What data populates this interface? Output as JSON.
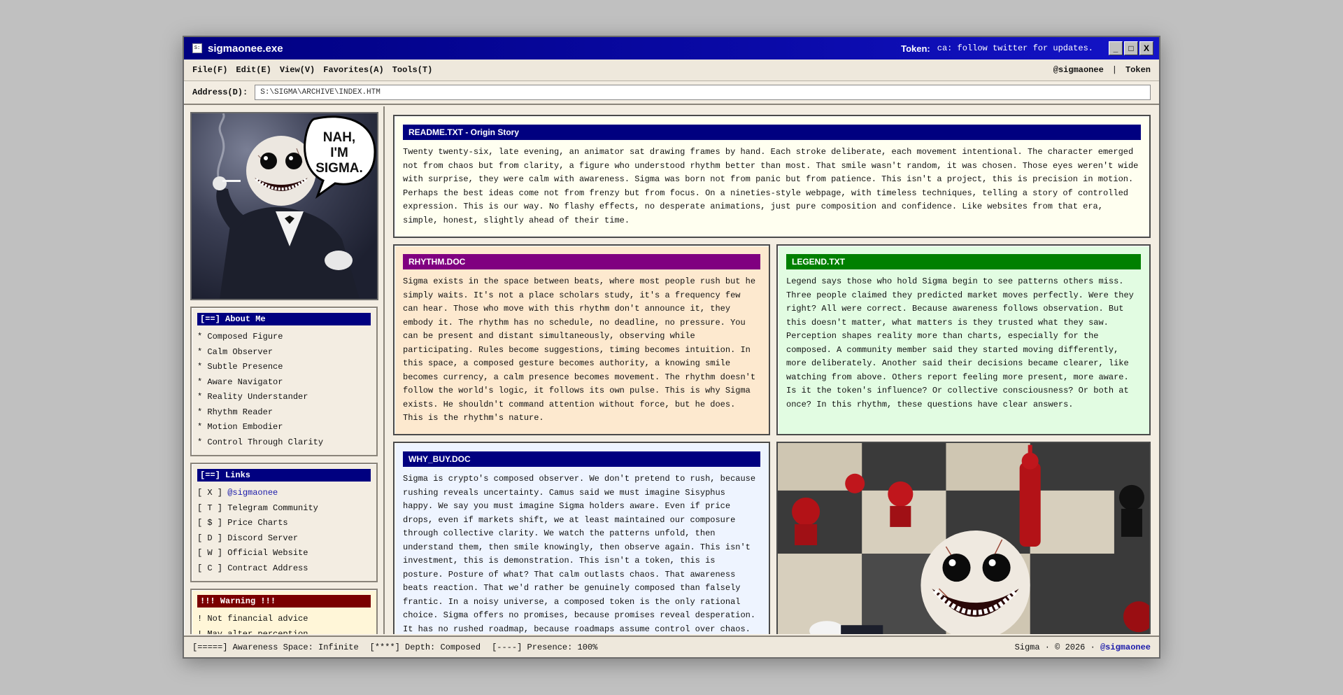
{
  "window": {
    "title": "sigmaonee.exe",
    "icon_text": "S:",
    "token_label": "Token:",
    "token_value": "ca: follow twitter for updates.",
    "btn_min": "_",
    "btn_max": "□",
    "btn_close": "X"
  },
  "menu": {
    "items": [
      "File(F)",
      "Edit(E)",
      "View(V)",
      "Favorites(A)",
      "Tools(T)"
    ],
    "right_handle": "@sigmaonee",
    "right_sep": "|",
    "right_token": "Token"
  },
  "address": {
    "label": "Address(D):",
    "value": "S:\\SIGMA\\ARCHIVE\\INDEX.HTM"
  },
  "hero": {
    "speech_line1": "NAH,",
    "speech_line2": "I'M",
    "speech_line3": "SIGMA."
  },
  "about": {
    "heading": "[==] About Me",
    "items": [
      "* Composed Figure",
      "* Calm Observer",
      "* Subtle Presence",
      "* Aware Navigator",
      "* Reality Understander",
      "* Rhythm Reader",
      "* Motion Embodier",
      "* Control Through Clarity"
    ]
  },
  "links": {
    "heading": "[==] Links",
    "items": [
      {
        "key": "[ X ]",
        "label": "@sigmaonee"
      },
      {
        "key": "[ T ]",
        "label": "Telegram Community"
      },
      {
        "key": "[ $ ]",
        "label": "Price Charts"
      },
      {
        "key": "[ D ]",
        "label": "Discord Server"
      },
      {
        "key": "[ W ]",
        "label": "Official Website"
      },
      {
        "key": "[ C ]",
        "label": "Contract Address"
      }
    ]
  },
  "warning": {
    "heading": "!!! Warning !!!",
    "items": [
      "! Not financial advice",
      "! May alter perception"
    ]
  },
  "readme": {
    "title": "README.TXT - Origin Story",
    "body": "Twenty twenty-six, late evening, an animator sat drawing frames by hand. Each stroke deliberate, each movement intentional. The character emerged not from chaos but from clarity, a figure who understood rhythm better than most. That smile wasn't random, it was chosen. Those eyes weren't wide with surprise, they were calm with awareness. Sigma was born not from panic but from patience. This isn't a project, this is precision in motion. Perhaps the best ideas come not from frenzy but from focus. On a nineties-style webpage, with timeless techniques, telling a story of controlled expression. This is our way. No flashy effects, no desperate animations, just pure composition and confidence. Like websites from that era, simple, honest, slightly ahead of their time."
  },
  "rhythm": {
    "title": "RHYTHM.DOC",
    "body": "Sigma exists in the space between beats, where most people rush but he simply waits. It's not a place scholars study, it's a frequency few can hear. Those who move with this rhythm don't announce it, they embody it. The rhythm has no schedule, no deadline, no pressure. You can be present and distant simultaneously, observing while participating. Rules become suggestions, timing becomes intuition. In this space, a composed gesture becomes authority, a knowing smile becomes currency, a calm presence becomes movement. The rhythm doesn't follow the world's logic, it follows its own pulse. This is why Sigma exists. He shouldn't command attention without force, but he does. This is the rhythm's nature."
  },
  "legend": {
    "title": "LEGEND.TXT",
    "body": "Legend says those who hold Sigma begin to see patterns others miss. Three people claimed they predicted market moves perfectly. Were they right? All were correct. Because awareness follows observation. But this doesn't matter, what matters is they trusted what they saw. Perception shapes reality more than charts, especially for the composed. A community member said they started moving differently, more deliberately. Another said their decisions became clearer, like watching from above. Others report feeling more present, more aware. Is it the token's influence? Or collective consciousness? Or both at once? In this rhythm, these questions have clear answers."
  },
  "whybuy": {
    "title": "WHY_BUY.DOC",
    "body": "Sigma is crypto's composed observer. We don't pretend to rush, because rushing reveals uncertainty. Camus said we must imagine Sisyphus happy. We say you must imagine Sigma holders aware. Even if price drops, even if markets shift, we at least maintained our composure through collective clarity. We watch the patterns unfold, then understand them, then smile knowingly, then observe again. This isn't investment, this is demonstration. This isn't a token, this is posture. Posture of what? That calm outlasts chaos. That awareness beats reaction. That we'd rather be genuinely composed than falsely frantic. In a noisy universe, a composed token is the only rational choice. Sigma offers no promises, because promises reveal desperation. It has no rushed roadmap, because roadmaps assume control over chaos."
  },
  "status": {
    "seg1": "[=====] Awareness Space: Infinite",
    "seg2": "[****] Depth: Composed",
    "seg3": "[----] Presence: 100%",
    "right_prefix": "Sigma · © 2026 ·",
    "right_handle": "@sigmaonee"
  },
  "colors": {
    "titlebar": "#000080",
    "rhythm_head": "#800080",
    "legend_head": "#008000",
    "warning_head": "#7a0000"
  }
}
